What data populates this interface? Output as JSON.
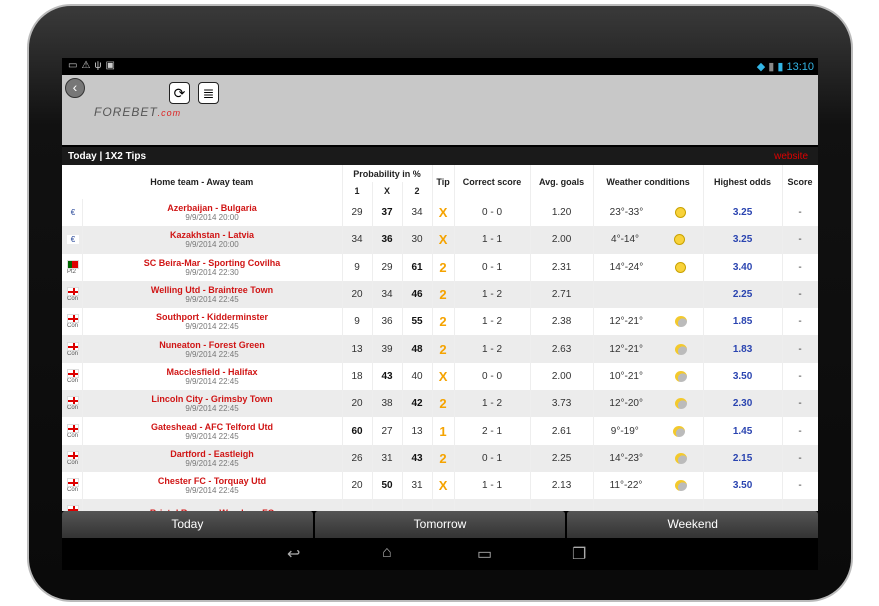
{
  "status": {
    "time": "13:10"
  },
  "header": {
    "logo": "FOREBET",
    "logo_suffix": ".com",
    "title": "Today | 1X2 Tips",
    "website": "website"
  },
  "columns": {
    "teams": "Home team - Away team",
    "prob": "Probability in %",
    "p1": "1",
    "px": "X",
    "p2": "2",
    "tip": "Tip",
    "correct": "Correct score",
    "avg": "Avg. goals",
    "weather": "Weather conditions",
    "odds": "Highest odds",
    "score": "Score"
  },
  "colors": {
    "team": "#d01515",
    "tip": "#f5a300",
    "odds": "#2a44b0",
    "title": "#1a1a1a"
  },
  "rows": [
    {
      "flag": "euro",
      "league": "",
      "teams": "Azerbaijan - Bulgaria",
      "date": "9/9/2014 20:00",
      "p1": "29",
      "px": "37",
      "p2": "34",
      "tip": "X",
      "correct": "0 - 0",
      "avg": "1.20",
      "weather": "23°-33°",
      "wicon": "sun",
      "odds": "3.25",
      "score": "-"
    },
    {
      "flag": "euro",
      "league": "",
      "teams": "Kazakhstan - Latvia",
      "date": "9/9/2014 20:00",
      "p1": "34",
      "px": "36",
      "p2": "30",
      "tip": "X",
      "correct": "1 - 1",
      "avg": "2.00",
      "weather": "4°-14°",
      "wicon": "sun",
      "odds": "3.25",
      "score": "-"
    },
    {
      "flag": "por",
      "league": "Pt2",
      "teams": "SC Beira-Mar - Sporting Covilha",
      "date": "9/9/2014 22:30",
      "p1": "9",
      "px": "29",
      "p2": "61",
      "tip": "2",
      "correct": "0 - 1",
      "avg": "2.31",
      "weather": "14°-24°",
      "wicon": "sun",
      "odds": "3.40",
      "score": "-"
    },
    {
      "flag": "eng",
      "league": "Con",
      "teams": "Welling Utd - Braintree Town",
      "date": "9/9/2014 22:45",
      "p1": "20",
      "px": "34",
      "p2": "46",
      "tip": "2",
      "correct": "1 - 2",
      "avg": "2.71",
      "weather": "",
      "wicon": "",
      "odds": "2.25",
      "score": "-"
    },
    {
      "flag": "eng",
      "league": "Con",
      "teams": "Southport - Kidderminster",
      "date": "9/9/2014 22:45",
      "p1": "9",
      "px": "36",
      "p2": "55",
      "tip": "2",
      "correct": "1 - 2",
      "avg": "2.38",
      "weather": "12°-21°",
      "wicon": "cloud",
      "odds": "1.85",
      "score": "-"
    },
    {
      "flag": "eng",
      "league": "Con",
      "teams": "Nuneaton - Forest Green",
      "date": "9/9/2014 22:45",
      "p1": "13",
      "px": "39",
      "p2": "48",
      "tip": "2",
      "correct": "1 - 2",
      "avg": "2.63",
      "weather": "12°-21°",
      "wicon": "cloud",
      "odds": "1.83",
      "score": "-"
    },
    {
      "flag": "eng",
      "league": "Con",
      "teams": "Macclesfield - Halifax",
      "date": "9/9/2014 22:45",
      "p1": "18",
      "px": "43",
      "p2": "40",
      "tip": "X",
      "correct": "0 - 0",
      "avg": "2.00",
      "weather": "10°-21°",
      "wicon": "cloud",
      "odds": "3.50",
      "score": "-"
    },
    {
      "flag": "eng",
      "league": "Con",
      "teams": "Lincoln City - Grimsby Town",
      "date": "9/9/2014 22:45",
      "p1": "20",
      "px": "38",
      "p2": "42",
      "tip": "2",
      "correct": "1 - 2",
      "avg": "3.73",
      "weather": "12°-20°",
      "wicon": "cloud",
      "odds": "2.30",
      "score": "-"
    },
    {
      "flag": "eng",
      "league": "Con",
      "teams": "Gateshead - AFC Telford Utd",
      "date": "9/9/2014 22:45",
      "p1": "60",
      "px": "27",
      "p2": "13",
      "tip": "1",
      "correct": "2 - 1",
      "avg": "2.61",
      "weather": "9°-19°",
      "wicon": "cloud",
      "odds": "1.45",
      "score": "-"
    },
    {
      "flag": "eng",
      "league": "Con",
      "teams": "Dartford - Eastleigh",
      "date": "9/9/2014 22:45",
      "p1": "26",
      "px": "31",
      "p2": "43",
      "tip": "2",
      "correct": "0 - 1",
      "avg": "2.25",
      "weather": "14°-23°",
      "wicon": "cloud",
      "odds": "2.15",
      "score": "-"
    },
    {
      "flag": "eng",
      "league": "Con",
      "teams": "Chester FC - Torquay Utd",
      "date": "9/9/2014 22:45",
      "p1": "20",
      "px": "50",
      "p2": "31",
      "tip": "X",
      "correct": "1 - 1",
      "avg": "2.13",
      "weather": "11°-22°",
      "wicon": "cloud",
      "odds": "3.50",
      "score": "-"
    },
    {
      "flag": "eng",
      "league": "Con",
      "teams": "Bristol Rovers - Wrexham FC",
      "date": "",
      "p1": "",
      "px": "",
      "p2": "",
      "tip": "",
      "correct": "",
      "avg": "",
      "weather": "",
      "wicon": "",
      "odds": "",
      "score": ""
    }
  ],
  "tabs": [
    "Today",
    "Tomorrow",
    "Weekend"
  ]
}
